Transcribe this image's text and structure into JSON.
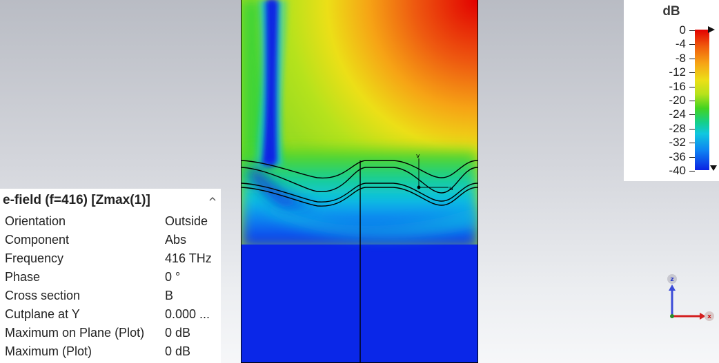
{
  "legend": {
    "unit": "dB",
    "ticks": [
      "0",
      "-4",
      "-8",
      "-12",
      "-16",
      "-20",
      "-24",
      "-28",
      "-32",
      "-36",
      "-40"
    ]
  },
  "plot": {
    "probe_labels": {
      "v": "v",
      "u": "u"
    }
  },
  "panel": {
    "title": "e-field (f=416) [Zmax(1)]",
    "collapse_icon": "chevron-up",
    "rows": [
      {
        "key": "Orientation",
        "value": "Outside"
      },
      {
        "key": "Component",
        "value": "Abs"
      },
      {
        "key": "Frequency",
        "value": "416 THz"
      },
      {
        "key": "Phase",
        "value": "0 °"
      },
      {
        "key": "Cross section",
        "value": "B"
      },
      {
        "key": "Cutplane at Y",
        "value": "0.000 ..."
      },
      {
        "key": "Maximum on Plane (Plot)",
        "value": "0 dB"
      },
      {
        "key": "Maximum (Plot)",
        "value": "0 dB"
      }
    ]
  },
  "axes": {
    "z": "z",
    "x": "x"
  },
  "colors": {
    "field_max": "#e20000",
    "field_min": "#0a27e8",
    "axis_z": "#3b4bd8",
    "axis_x": "#d42020"
  }
}
